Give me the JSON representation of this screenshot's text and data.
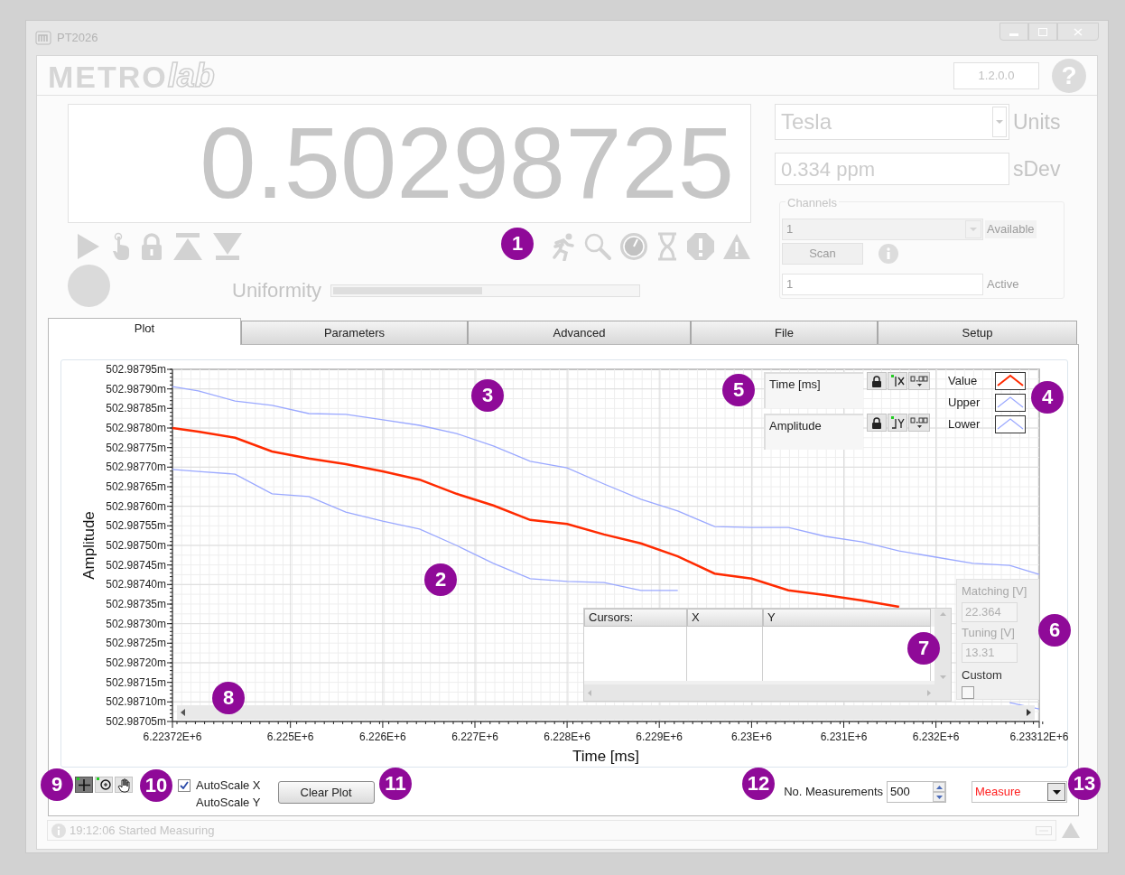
{
  "window": {
    "title": "PT2026"
  },
  "header": {
    "logo": [
      "METRO",
      "lab"
    ],
    "version": "1.2.0.0",
    "help": "?"
  },
  "readout": {
    "value": "0.50298725"
  },
  "uniformity": {
    "label": "Uniformity",
    "level": 0.49
  },
  "units": {
    "value": "Tesla",
    "label": "Units"
  },
  "sdev": {
    "value": "0.334 ppm",
    "label": "sDev"
  },
  "channels": {
    "title": "Channels",
    "available": {
      "value": "1",
      "label": "Available",
      "disabled": true
    },
    "scan_button": {
      "label": "Scan",
      "disabled": true
    },
    "active": {
      "value": "1",
      "label": "Active"
    }
  },
  "tabs": [
    {
      "label": "Plot",
      "selected": true
    },
    {
      "label": "Parameters",
      "selected": false
    },
    {
      "label": "Advanced",
      "selected": false
    },
    {
      "label": "File",
      "selected": false
    },
    {
      "label": "Setup",
      "selected": false
    }
  ],
  "plot": {
    "chart_data": {
      "type": "line",
      "xlabel": "Time [ms]",
      "ylabel": "Amplitude",
      "x": [
        6223720,
        6224000,
        6224400,
        6224800,
        6225200,
        6225600,
        6226000,
        6226400,
        6226800,
        6227200,
        6227600,
        6228000,
        6228400,
        6228800,
        6229200,
        6229600,
        6230000,
        6230400,
        6230800,
        6231200,
        6231600,
        6232000,
        6232400,
        6232800,
        6233120
      ],
      "series": [
        {
          "name": "Value",
          "color": "#ff2a00",
          "values": [
            502.9878,
            502.987791,
            502.987775,
            502.98774,
            502.987722,
            502.987708,
            502.987689,
            502.987668,
            502.987632,
            502.987602,
            502.987565,
            502.987555,
            502.987528,
            502.987505,
            502.987472,
            502.987428,
            502.987415,
            502.987385,
            502.987373,
            502.987359,
            502.987343,
            null,
            null,
            null,
            null
          ]
        },
        {
          "name": "Upper",
          "color": "#9aa8ff",
          "values": [
            502.987906,
            502.987895,
            502.987869,
            502.987858,
            502.987837,
            502.987835,
            502.987821,
            502.987807,
            502.987786,
            502.987754,
            502.987715,
            502.987698,
            502.987657,
            502.987618,
            502.987588,
            502.987548,
            502.987546,
            502.987546,
            502.987523,
            502.987509,
            502.987486,
            502.98747,
            502.987454,
            502.987449,
            502.987426
          ]
        },
        {
          "name": "Lower",
          "color": "#9aa8ff",
          "values": [
            502.987694,
            502.987689,
            502.987682,
            502.987632,
            502.987625,
            502.987585,
            502.987562,
            502.987542,
            502.9875,
            502.987454,
            502.987415,
            502.987408,
            502.987405,
            502.987385,
            502.987385,
            null,
            null,
            null,
            null,
            null,
            null,
            null,
            null,
            502.987098,
            502.987082
          ]
        }
      ],
      "grid": true,
      "xlim": [
        6223720,
        6233120
      ],
      "ylim": [
        502.98705,
        502.98795
      ],
      "xticks": [
        {
          "value": 6223720,
          "label": "6.22372E+6"
        },
        {
          "value": 6225000,
          "label": "6.225E+6"
        },
        {
          "value": 6226000,
          "label": "6.226E+6"
        },
        {
          "value": 6227000,
          "label": "6.227E+6"
        },
        {
          "value": 6228000,
          "label": "6.228E+6"
        },
        {
          "value": 6229000,
          "label": "6.229E+6"
        },
        {
          "value": 6230000,
          "label": "6.23E+6"
        },
        {
          "value": 6231000,
          "label": "6.231E+6"
        },
        {
          "value": 6232000,
          "label": "6.232E+6"
        },
        {
          "value": 6233120,
          "label": "6.23312E+6"
        }
      ],
      "yticks": [
        {
          "value": 502.98705,
          "label": "502.98705m"
        },
        {
          "value": 502.9871,
          "label": "502.98710m"
        },
        {
          "value": 502.98715,
          "label": "502.98715m"
        },
        {
          "value": 502.9872,
          "label": "502.98720m"
        },
        {
          "value": 502.98725,
          "label": "502.98725m"
        },
        {
          "value": 502.9873,
          "label": "502.98730m"
        },
        {
          "value": 502.98735,
          "label": "502.98735m"
        },
        {
          "value": 502.9874,
          "label": "502.98740m"
        },
        {
          "value": 502.98745,
          "label": "502.98745m"
        },
        {
          "value": 502.9875,
          "label": "502.98750m"
        },
        {
          "value": 502.98755,
          "label": "502.98755m"
        },
        {
          "value": 502.9876,
          "label": "502.98760m"
        },
        {
          "value": 502.98765,
          "label": "502.98765m"
        },
        {
          "value": 502.9877,
          "label": "502.98770m"
        },
        {
          "value": 502.98775,
          "label": "502.98775m"
        },
        {
          "value": 502.9878,
          "label": "502.98780m"
        },
        {
          "value": 502.98785,
          "label": "502.98785m"
        },
        {
          "value": 502.9879,
          "label": "502.98790m"
        },
        {
          "value": 502.98795,
          "label": "502.98795m"
        }
      ]
    },
    "scale_legend": [
      {
        "label": "Time [ms]"
      },
      {
        "label": "Amplitude"
      }
    ],
    "cursors": {
      "columns": [
        "Cursors:",
        "X",
        "Y"
      ]
    },
    "matching": {
      "matching_label": "Matching [V]",
      "matching_value": "22.364",
      "tuning_label": "Tuning [V]",
      "tuning_value": "13.31",
      "custom_label": "Custom",
      "custom_checked": false
    }
  },
  "tools": [
    {
      "kind": "cursor",
      "selected": true
    },
    {
      "kind": "zoom",
      "selected": false
    },
    {
      "kind": "pan",
      "selected": false
    }
  ],
  "autoscale": [
    {
      "label": "AutoScale X",
      "checked": true
    },
    {
      "label": "AutoScale Y"
    }
  ],
  "clear_button": "Clear Plot",
  "measurements": {
    "label": "No. Measurements",
    "value": "500"
  },
  "mode": {
    "value": "Measure"
  },
  "status": {
    "message": "19:12:06 Started Measuring"
  },
  "callouts": [
    "1",
    "2",
    "3",
    "4",
    "5",
    "6",
    "7",
    "8",
    "9",
    "10",
    "11",
    "12",
    "13"
  ]
}
